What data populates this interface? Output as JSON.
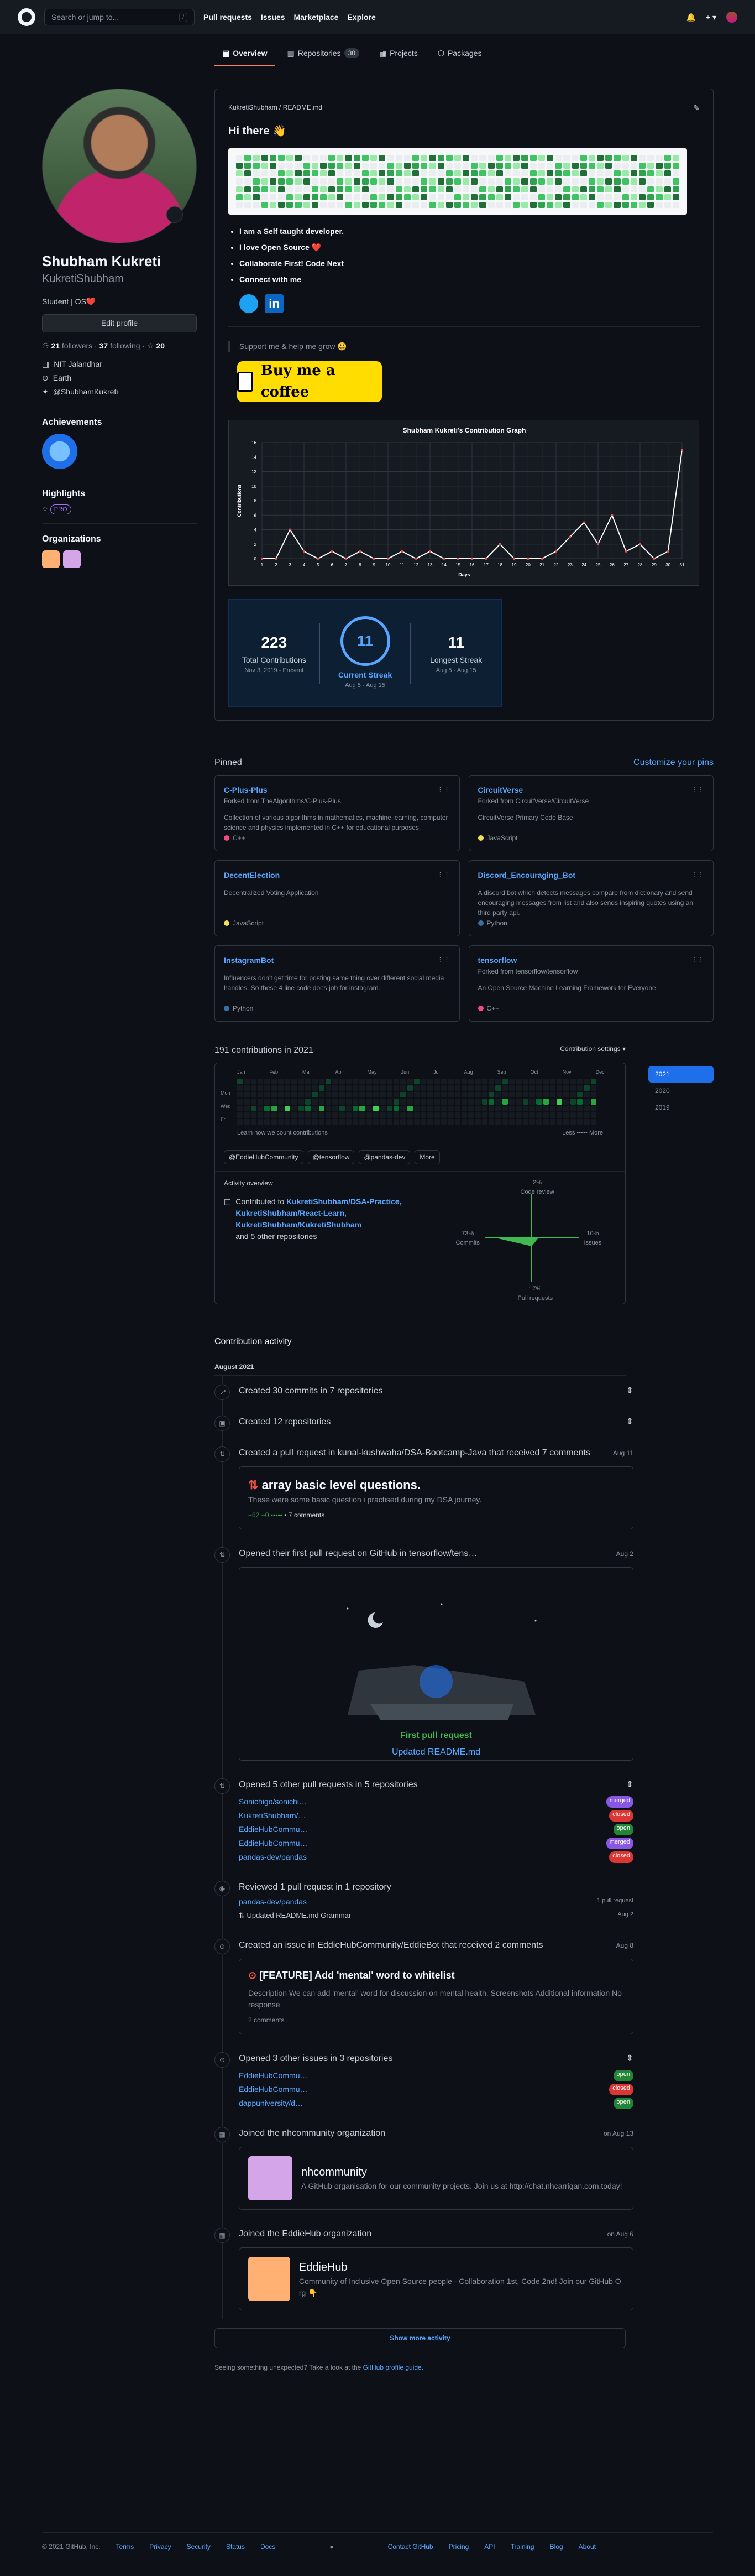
{
  "header": {
    "search_placeholder": "Search or jump to...",
    "slash": "/",
    "nav": [
      "Pull requests",
      "Issues",
      "Marketplace",
      "Explore"
    ],
    "plus": "+ ▾"
  },
  "tabs": [
    {
      "label": "Overview"
    },
    {
      "label": "Repositories",
      "count": "30"
    },
    {
      "label": "Projects"
    },
    {
      "label": "Packages"
    }
  ],
  "profile": {
    "name": "Shubham Kukreti",
    "username": "KukretiShubham",
    "bio": "Student | OS❤️",
    "edit": "Edit profile",
    "followers": "21",
    "followers_label": "followers",
    "following": "37",
    "following_label": "following",
    "stars": "20",
    "org": "NIT Jalandhar",
    "location": "Earth",
    "twitter": "@ShubhamKukreti"
  },
  "sidebar": {
    "achievements": "Achievements",
    "highlights": "Highlights",
    "pro": "PRO",
    "organizations": "Organizations"
  },
  "readme": {
    "crumb": "KukretiShubham / README.md",
    "title": "Hi there 👋",
    "bullets": [
      "I am a Self taught developer.",
      "I love Open Source ❤️",
      "Collaborate First! Code Next",
      "Connect with me"
    ],
    "support": "Support me & help me grow 😃",
    "coffee": "Buy me a coffee"
  },
  "chart_data": {
    "type": "line",
    "title": "Shubham Kukreti's Contribution Graph",
    "xlabel": "Days",
    "ylabel": "Contributions",
    "x": [
      1,
      2,
      3,
      4,
      5,
      6,
      7,
      8,
      9,
      10,
      11,
      12,
      13,
      14,
      15,
      16,
      17,
      18,
      19,
      20,
      21,
      22,
      23,
      24,
      25,
      26,
      27,
      28,
      29,
      30,
      31
    ],
    "values": [
      0,
      0,
      4,
      1,
      0,
      1,
      0,
      1,
      0,
      0,
      1,
      0,
      1,
      0,
      0,
      0,
      0,
      2,
      0,
      0,
      0,
      1,
      3,
      5,
      2,
      6,
      1,
      2,
      0,
      1,
      15
    ],
    "ylim": [
      0,
      16
    ],
    "yticks": [
      0,
      2,
      4,
      6,
      8,
      10,
      12,
      14,
      16
    ]
  },
  "stats": {
    "total": "223",
    "total_label": "Total Contributions",
    "total_range": "Nov 3, 2019 - Present",
    "current": "11",
    "current_label": "Current Streak",
    "current_range": "Aug 5 - Aug 15",
    "longest": "11",
    "longest_label": "Longest Streak",
    "longest_range": "Aug 5 - Aug 15"
  },
  "pinned": {
    "title": "Pinned",
    "customize": "Customize your pins",
    "items": [
      {
        "name": "C-Plus-Plus",
        "fork": "Forked from TheAlgorithms/C-Plus-Plus",
        "desc": "Collection of various algorithms in mathematics, machine learning, computer science and physics implemented in C++ for educational purposes.",
        "lang": "C++",
        "color": "#f34b7d"
      },
      {
        "name": "CircuitVerse",
        "fork": "Forked from CircuitVerse/CircuitVerse",
        "desc": "CircuitVerse Primary Code Base",
        "lang": "JavaScript",
        "color": "#f1e05a"
      },
      {
        "name": "DecentElection",
        "fork": "",
        "desc": "Decentralized Voting Application",
        "lang": "JavaScript",
        "color": "#f1e05a"
      },
      {
        "name": "Discord_Encouraging_Bot",
        "fork": "",
        "desc": "A discord bot which detects messages compare from dictionary and send encouraging messages from list and also sends inspiring quotes using an third party api.",
        "lang": "Python",
        "color": "#3572A5"
      },
      {
        "name": "InstagramBot",
        "fork": "",
        "desc": "Influencers don't get time for posting same thing over different social media handles. So these 4 line code does job for instagram.",
        "lang": "Python",
        "color": "#3572A5"
      },
      {
        "name": "tensorflow",
        "fork": "Forked from tensorflow/tensorflow",
        "desc": "An Open Source Machine Learning Framework for Everyone",
        "lang": "C++",
        "color": "#f34b7d"
      }
    ]
  },
  "contrib": {
    "title": "191 contributions in 2021",
    "settings": "Contribution settings ▾",
    "years": [
      "2021",
      "2020",
      "2019"
    ],
    "months": [
      "Jan",
      "Feb",
      "Mar",
      "Apr",
      "May",
      "Jun",
      "Jul",
      "Aug",
      "Sep",
      "Oct",
      "Nov",
      "Dec"
    ],
    "days": [
      "Mon",
      "Wed",
      "Fri"
    ],
    "learn": "Learn how we count contributions",
    "less": "Less",
    "more": "More",
    "orgs": [
      "@EddieHubCommunity",
      "@tensorflow",
      "@pandas-dev",
      "More"
    ],
    "overview": "Activity overview",
    "contributed": "Contributed to",
    "repos": "KukretiShubham/DSA-Practice, KukretiShubham/React-Learn, KukretiShubham/KukretiShubham",
    "others": "and 5 other repositories",
    "axes": [
      {
        "p": "2%",
        "l": "Code review"
      },
      {
        "p": "73%",
        "l": "Commits"
      },
      {
        "p": "10%",
        "l": "Issues"
      },
      {
        "p": "17%",
        "l": "Pull requests"
      }
    ]
  },
  "activity": {
    "title": "Contribution activity",
    "month": "August 2021",
    "events": [
      {
        "icon": "⎇",
        "text": "Created 30 commits in 7 repositories",
        "date": ""
      },
      {
        "icon": "▣",
        "text": "Created 12 repositories",
        "date": ""
      },
      {
        "icon": "⇅",
        "text": "Created a pull request in kunal-kushwaha/DSA-Bootcamp-Java that received 7 comments",
        "date": "Aug 11"
      },
      {
        "icon": "⇅",
        "text": "Opened their first pull request on GitHub in tensorflow/tens…",
        "date": "Aug 2"
      },
      {
        "icon": "⇅",
        "text": "Opened 5 other pull requests in 5 repositories",
        "date": ""
      },
      {
        "icon": "◉",
        "text": "Reviewed 1 pull request in 1 repository",
        "date": ""
      },
      {
        "icon": "⊙",
        "text": "Created an issue in EddieHubCommunity/EddieBot that received 2 comments",
        "date": "Aug 8"
      },
      {
        "icon": "⊙",
        "text": "Opened 3 other issues in 3 repositories",
        "date": ""
      },
      {
        "icon": "▦",
        "text": "Joined the nhcommunity organization",
        "date": "on Aug 13"
      },
      {
        "icon": "▦",
        "text": "Joined the EddieHub organization",
        "date": "on Aug 6"
      }
    ],
    "pr": {
      "title": "array basic level questions.",
      "desc": "These were some basic question i practised during my DSA journey.",
      "diff": "+62 −0",
      "comments": "• 7 comments"
    },
    "first_pr": {
      "label": "First pull request",
      "title": "Updated README.md"
    },
    "other_prs": [
      {
        "repo": "Sonichigo/sonichi…",
        "state": "merged"
      },
      {
        "repo": "KukretiShubham/…",
        "state": "closed"
      },
      {
        "repo": "EddieHubCommu…",
        "state": "open"
      },
      {
        "repo": "EddieHubCommu…",
        "state": "merged"
      },
      {
        "repo": "pandas-dev/pandas",
        "state": "closed"
      }
    ],
    "review": {
      "repo": "pandas-dev/pandas",
      "count": "1 pull request",
      "pr": "Updated README.md Grammar",
      "date": "Aug 2"
    },
    "issue": {
      "title": "[FEATURE] Add 'mental' word to whitelist",
      "desc": "Description We can add 'mental' word for discussion on mental health. Screenshots Additional information No response",
      "comments": "2 comments"
    },
    "other_issues": [
      {
        "repo": "EddieHubCommu…",
        "state": "open"
      },
      {
        "repo": "EddieHubCommu…",
        "state": "closed"
      },
      {
        "repo": "dappuniversity/d…",
        "state": "open"
      }
    ],
    "nh": {
      "name": "nhcommunity",
      "desc": "A GitHub organisation for our community projects. Join us at http://chat.nhcarrigan.com.today!"
    },
    "eh": {
      "name": "EddieHub",
      "desc": "Community of Inclusive Open Source people - Collaboration 1st, Code 2nd! Join our GitHub O rg 👇"
    },
    "show_more": "Show more activity",
    "note": "Seeing something unexpected? Take a look at the",
    "note_link": "GitHub profile guide."
  },
  "footer": {
    "copy": "© 2021 GitHub, Inc.",
    "links": [
      "Terms",
      "Privacy",
      "Security",
      "Status",
      "Docs",
      "Contact GitHub",
      "Pricing",
      "API",
      "Training",
      "Blog",
      "About"
    ]
  }
}
